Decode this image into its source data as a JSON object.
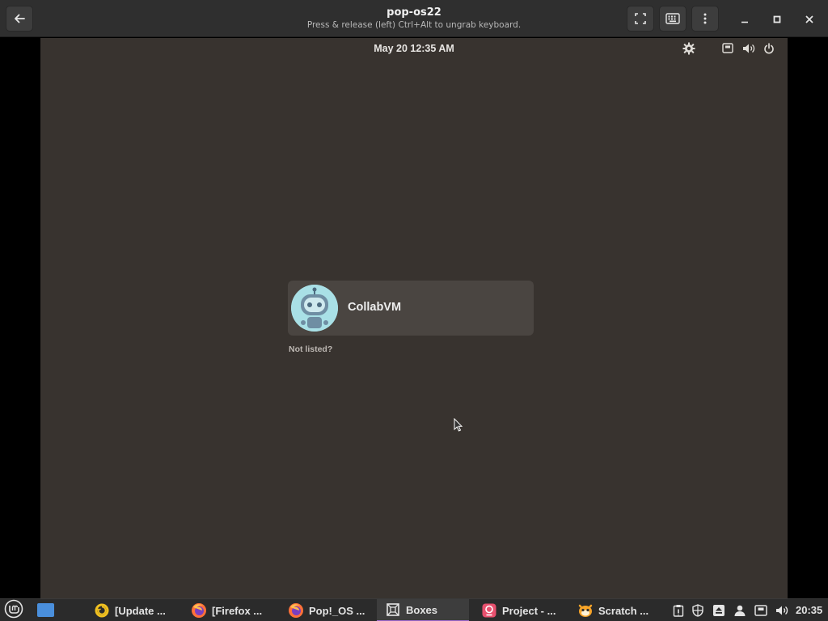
{
  "window": {
    "title": "pop-os22",
    "subtitle": "Press & release (left) Ctrl+Alt to ungrab keyboard."
  },
  "icons": {
    "back": "arrow-left-icon",
    "fullscreen": "fullscreen-icon",
    "keyboard": "keyboard-icon",
    "menu": "vertical-dots-menu-icon",
    "minimize": "minimize-icon",
    "maximize": "maximize-icon",
    "close": "close-icon"
  },
  "vm": {
    "clock": "May 20  12:35 AM",
    "user": {
      "name": "CollabVM",
      "avatar": "robot-avatar-icon"
    },
    "not_listed": "Not listed?"
  },
  "taskbar": {
    "tasks": [
      {
        "label": "[Update ...",
        "icon": "update-manager-icon",
        "active": false
      },
      {
        "label": "[Firefox ...",
        "icon": "firefox-icon",
        "active": false
      },
      {
        "label": "Pop!_OS ...",
        "icon": "firefox-icon",
        "active": false
      },
      {
        "label": "Boxes",
        "icon": "boxes-icon",
        "active": true
      },
      {
        "label": "Project - ...",
        "icon": "project-icon",
        "active": false
      },
      {
        "label": "Scratch ...",
        "icon": "scratch-cat-icon",
        "active": false
      }
    ],
    "clock": "20:35"
  },
  "colors": {
    "header_bg": "#2f2f2f",
    "vm_bg": "#38332f",
    "card_bg": "#4a4541",
    "taskbar_bg": "#2b2b2b",
    "active_underline": "#9b67c9"
  }
}
